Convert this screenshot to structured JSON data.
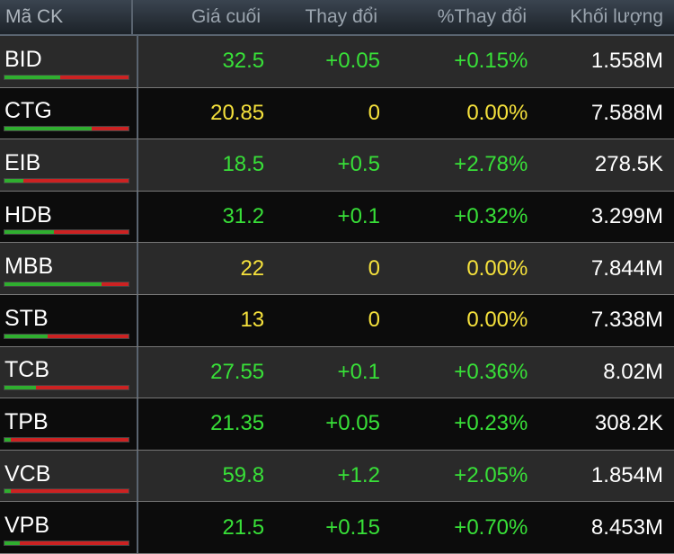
{
  "header": {
    "symbol": "Mã CK",
    "price": "Giá cuối",
    "change": "Thay đổi",
    "pct": "%Thay đổi",
    "volume": "Khối lượng"
  },
  "colors": {
    "up": "#38e038",
    "reference": "#f5e13c",
    "buy_bar": "#2fae2f",
    "sell_bar": "#cc2222"
  },
  "rows": [
    {
      "symbol": "BID",
      "price": "32.5",
      "change": "+0.05",
      "pct": "+0.15%",
      "volume": "1.558M",
      "trend": "up",
      "buy_ratio": 0.45
    },
    {
      "symbol": "CTG",
      "price": "20.85",
      "change": "0",
      "pct": "0.00%",
      "volume": "7.588M",
      "trend": "ref",
      "buy_ratio": 0.7
    },
    {
      "symbol": "EIB",
      "price": "18.5",
      "change": "+0.5",
      "pct": "+2.78%",
      "volume": "278.5K",
      "trend": "up",
      "buy_ratio": 0.15
    },
    {
      "symbol": "HDB",
      "price": "31.2",
      "change": "+0.1",
      "pct": "+0.32%",
      "volume": "3.299M",
      "trend": "up",
      "buy_ratio": 0.4
    },
    {
      "symbol": "MBB",
      "price": "22",
      "change": "0",
      "pct": "0.00%",
      "volume": "7.844M",
      "trend": "ref",
      "buy_ratio": 0.78
    },
    {
      "symbol": "STB",
      "price": "13",
      "change": "0",
      "pct": "0.00%",
      "volume": "7.338M",
      "trend": "ref",
      "buy_ratio": 0.35
    },
    {
      "symbol": "TCB",
      "price": "27.55",
      "change": "+0.1",
      "pct": "+0.36%",
      "volume": "8.02M",
      "trend": "up",
      "buy_ratio": 0.25
    },
    {
      "symbol": "TPB",
      "price": "21.35",
      "change": "+0.05",
      "pct": "+0.23%",
      "volume": "308.2K",
      "trend": "up",
      "buy_ratio": 0.05
    },
    {
      "symbol": "VCB",
      "price": "59.8",
      "change": "+1.2",
      "pct": "+2.05%",
      "volume": "1.854M",
      "trend": "up",
      "buy_ratio": 0.05
    },
    {
      "symbol": "VPB",
      "price": "21.5",
      "change": "+0.15",
      "pct": "+0.70%",
      "volume": "8.453M",
      "trend": "up",
      "buy_ratio": 0.12
    }
  ]
}
